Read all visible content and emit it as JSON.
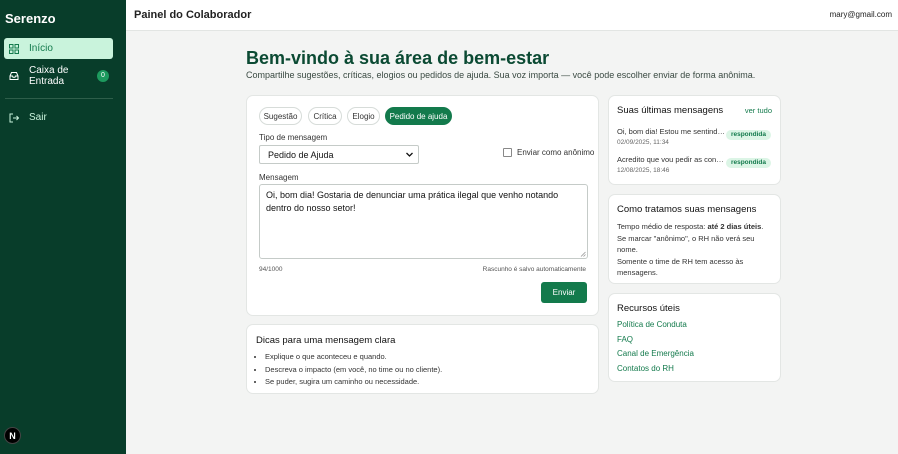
{
  "sidebar": {
    "brand": "Serenzo",
    "items": [
      {
        "label": "Início",
        "icon": "dashboard-icon"
      },
      {
        "label": "Caixa de Entrada",
        "icon": "inbox-icon",
        "badge": "0"
      }
    ],
    "logout_label": "Sair",
    "bottom_badge": "N"
  },
  "header": {
    "title": "Painel do Colaborador",
    "user_email": "mary@gmail.com"
  },
  "hero": {
    "title": "Bem-vindo à sua área de bem-estar",
    "subtitle": "Compartilhe sugestões, críticas, elogios ou pedidos de ajuda. Sua voz importa — você pode escolher enviar de forma anônima."
  },
  "form": {
    "tabs": [
      "Sugestão",
      "Crítica",
      "Elogio",
      "Pedido de ajuda"
    ],
    "active_tab": "Pedido de ajuda",
    "type_label": "Tipo de mensagem",
    "type_value": "Pedido de Ajuda",
    "anon_label": "Enviar como anônimo",
    "anon_checked": false,
    "message_label": "Mensagem",
    "message_value": "Oi, bom dia! Gostaria de denunciar uma prática ilegal que venho notando dentro do nosso setor!",
    "char_count": "94/1000",
    "draft_note": "Rascunho é salvo automaticamente",
    "send_label": "Enviar"
  },
  "tips": {
    "title": "Dicas para uma mensagem clara",
    "items": [
      "Explique o que aconteceu e quando.",
      "Descreva o impacto (em você, no time ou no cliente).",
      "Se puder, sugira um caminho ou necessidade."
    ]
  },
  "recent": {
    "title": "Suas últimas mensagens",
    "see_all": "ver tudo",
    "messages": [
      {
        "text": "Oi, bom dia! Estou me sentindo...",
        "date": "02/09/2025, 11:34",
        "status": "respondida"
      },
      {
        "text": "Acredito que vou pedir as contas...",
        "date": "12/08/2025, 18:46",
        "status": "respondida"
      }
    ]
  },
  "handling": {
    "title": "Como tratamos suas mensagens",
    "line1_prefix": "Tempo médio de resposta: ",
    "line1_bold": "até 2 dias úteis",
    "line1_suffix": ".",
    "line2": "Se marcar \"anônimo\", o RH não verá seu nome.",
    "line3": "Somente o time de RH tem acesso às mensagens."
  },
  "resources": {
    "title": "Recursos úteis",
    "links": [
      "Política de Conduta",
      "FAQ",
      "Canal de Emergência",
      "Contatos do RH"
    ]
  },
  "colors": {
    "accent": "#137a4c",
    "sidebar_bg": "#083d2a",
    "active_bg": "#c9f3dc"
  }
}
